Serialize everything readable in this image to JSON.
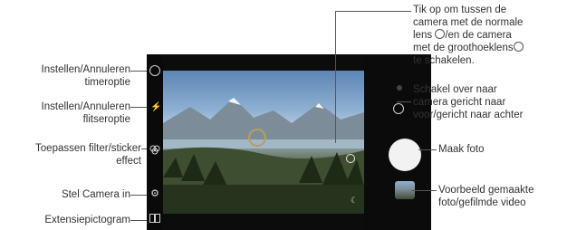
{
  "labels": {
    "timer": [
      "Instellen/Annuleren",
      "timeroptie"
    ],
    "flash": [
      "Instellen/Annuleren",
      "flitseroptie"
    ],
    "filter": [
      "Toepassen filter/sticker",
      "effect"
    ],
    "settings": "Stel Camera in",
    "extension": "Extensiepictogram",
    "lens_switch": [
      "Tik op om tussen de",
      "camera met de normale",
      "lens",
      "/en de camera",
      "met de groothoeklens",
      "te schakelen."
    ],
    "front_rear": [
      "Schakel over naar",
      "camera gericht naar",
      "voor/gericht naar achter"
    ],
    "shutter": "Maak foto",
    "preview": [
      "Voorbeeld gemaakte",
      "foto/gefilmde video"
    ]
  },
  "icons": {
    "timer": "timer-icon",
    "flash": "flash-off-icon",
    "filter": "filter-icon",
    "settings": "gear-icon",
    "extension": "extension-icon",
    "lens_normal": "normal-lens-icon",
    "lens_wide": "wide-lens-icon",
    "switch_camera": "switch-camera-icon",
    "shutter": "shutter-button",
    "thumbnail": "gallery-thumbnail"
  },
  "colors": {
    "line": "#555555",
    "phone": "#0c0c0c",
    "shutter": "#f2f2f2"
  }
}
